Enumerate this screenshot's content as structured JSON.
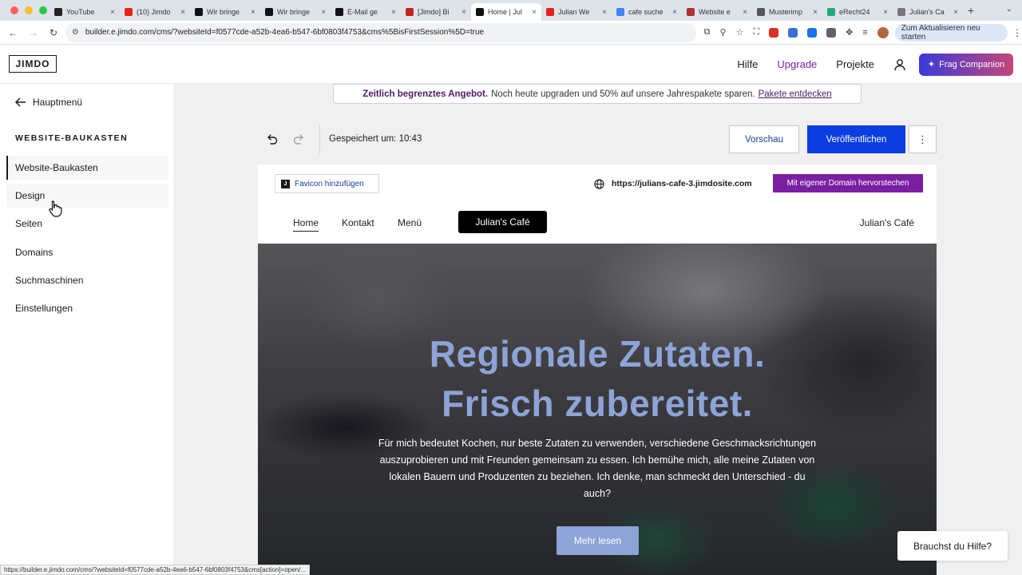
{
  "browser": {
    "tabs": [
      {
        "title": "YouTube",
        "color": "#222"
      },
      {
        "title": "(10) Jimdo",
        "color": "#e62117"
      },
      {
        "title": "Wir bringe",
        "color": "#111"
      },
      {
        "title": "Wir bringe",
        "color": "#111"
      },
      {
        "title": "E-Mail ge",
        "color": "#111"
      },
      {
        "title": "[Jimdo] Bi",
        "color": "#c5221f"
      },
      {
        "title": "Home | Jul",
        "color": "#111",
        "active": true
      },
      {
        "title": "Julian We",
        "color": "#e62117"
      },
      {
        "title": "cafe suche",
        "color": "#4285f4"
      },
      {
        "title": "Website e",
        "color": "#a33"
      },
      {
        "title": "Musterimp",
        "color": "#555"
      },
      {
        "title": "eRecht24",
        "color": "#2a7"
      },
      {
        "title": "Julian's Ca",
        "color": "#777"
      }
    ],
    "new_tab": "+",
    "url": "builder.e.jimdo.com/cms/?websiteId=f0577cde-a52b-4ea6-b547-6bf0803f4753&cms%5BisFirstSession%5D=true",
    "update_button": "Zum Aktualisieren neu starten",
    "status_url": "https://builder.e.jimdo.com/cms/?websiteId=f0577cde-a52b-4ea6-b547-6bf0803f4753&cms[action]=open/..."
  },
  "header": {
    "logo": "JIMDO",
    "nav": {
      "help": "Hilfe",
      "upgrade": "Upgrade",
      "projects": "Projekte"
    },
    "companion": "Frag Companion"
  },
  "sidebar": {
    "back": "Hauptmenü",
    "heading": "WEBSITE-BAUKASTEN",
    "items": [
      {
        "label": "Website-Baukasten"
      },
      {
        "label": "Design"
      },
      {
        "label": "Seiten"
      },
      {
        "label": "Domains"
      },
      {
        "label": "Suchmaschinen"
      },
      {
        "label": "Einstellungen"
      }
    ]
  },
  "banner": {
    "bold": "Zeitlich begrenztes Angebot.",
    "text": "Noch heute upgraden und 50% auf unsere Jahrespakete sparen.",
    "link": "Pakete entdecken"
  },
  "toolbar": {
    "saved": "Gespeichert um: 10:43",
    "preview": "Vorschau",
    "publish": "Veröffentlichen"
  },
  "site": {
    "favicon_button": "Favicon hinzufügen",
    "site_url": "https://julians-cafe-3.jimdosite.com",
    "domain_button": "Mit eigener Domain hervorstechen",
    "nav": {
      "home": "Home",
      "contact": "Kontakt",
      "menu": "Menü",
      "logo": "Julian's Café",
      "right": "Julian's Café"
    },
    "hero": {
      "title_line1": "Regionale Zutaten.",
      "title_line2": "Frisch zubereitet.",
      "text": "Für mich bedeutet Kochen, nur beste Zutaten zu verwenden, verschiedene Geschmacksrichtungen auszuprobieren und mit Freunden gemeinsam zu essen. Ich bemühe mich, alle meine Zutaten von lokalen Bauern und Produzenten zu beziehen. Ich denke, man schmeckt den Unterschied - du auch?",
      "button": "Mehr lesen"
    }
  },
  "help_chip": "Brauchst du Hilfe?",
  "colors": {
    "accent": "#0b3de0",
    "upgrade_purple": "#7a1fa2",
    "hero_blue": "#8ea3d6"
  }
}
